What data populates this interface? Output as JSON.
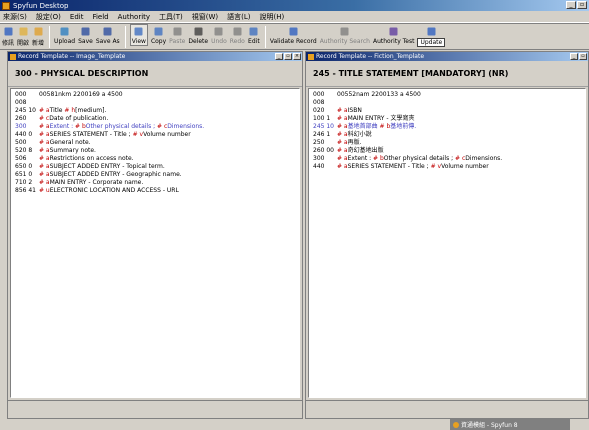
{
  "window": {
    "title": "Spyfun Desktop"
  },
  "menu": [
    "來源(S)",
    "設定(O)",
    "Edit",
    "Field",
    "Authority",
    "工具(T)",
    "視窗(W)",
    "語言(L)",
    "說明(H)"
  ],
  "toolbar": [
    {
      "label": "修訊",
      "icon": "book-icon",
      "color": "#3060c0"
    },
    {
      "label": "開啟",
      "icon": "folder-open-icon",
      "color": "#e0b040"
    },
    {
      "label": "新增",
      "icon": "new-record-icon",
      "color": "#e0a030"
    },
    {
      "label": "Upload",
      "icon": "upload-icon",
      "color": "#3080c0"
    },
    {
      "label": "Save",
      "icon": "save-icon",
      "color": "#3050a0"
    },
    {
      "label": "Save As",
      "icon": "save-as-icon",
      "color": "#3050a0"
    },
    {
      "label": "View",
      "icon": "view-icon",
      "color": "#4070c0",
      "active": true
    },
    {
      "label": "Copy",
      "icon": "copy-icon",
      "color": "#4070c0"
    },
    {
      "label": "Paste",
      "icon": "paste-icon",
      "color": "#808080",
      "disabled": true
    },
    {
      "label": "Delete",
      "icon": "delete-icon",
      "color": "#404040"
    },
    {
      "label": "Undo",
      "icon": "undo-icon",
      "color": "#808080",
      "disabled": true
    },
    {
      "label": "Redo",
      "icon": "redo-icon",
      "color": "#808080",
      "disabled": true
    },
    {
      "label": "Edit",
      "icon": "edit-icon",
      "color": "#4070c0"
    },
    {
      "label": "Validate Record",
      "icon": "validate-icon",
      "color": "#3060c0"
    },
    {
      "label": "Authority Search",
      "icon": "authority-search-icon",
      "color": "#808080",
      "disabled": true
    },
    {
      "label": "Authority Test",
      "icon": "authority-test-icon",
      "color": "#6040a0"
    },
    {
      "label": "Update",
      "icon": "update-icon",
      "color": "#3060c0",
      "boxed": true
    }
  ],
  "left_pane": {
    "title": "Record Template -- Image_Template",
    "heading": "300 - PHYSICAL DESCRIPTION",
    "lines": [
      {
        "tag": "000",
        "parts": [
          {
            "t": "00581nkm  2200169 a 4500"
          }
        ]
      },
      {
        "tag": "008",
        "parts": []
      },
      {
        "tag": "245 10",
        "parts": [
          {
            "t": "# a",
            "sf": true
          },
          {
            "t": "Title "
          },
          {
            "t": "# h",
            "sf": true
          },
          {
            "t": "[medium]."
          }
        ]
      },
      {
        "tag": "260",
        "parts": [
          {
            "t": "# c",
            "sf": true
          },
          {
            "t": "Date of publication."
          }
        ]
      },
      {
        "tag": "300",
        "hl": true,
        "parts": [
          {
            "t": "# a",
            "sf": true
          },
          {
            "t": "Extent : "
          },
          {
            "t": "# b",
            "sf": true
          },
          {
            "t": "Other physical details ; "
          },
          {
            "t": "# c",
            "sf": true
          },
          {
            "t": "Dimensions."
          }
        ]
      },
      {
        "tag": "440  0",
        "parts": [
          {
            "t": "# a",
            "sf": true
          },
          {
            "t": "SERIES STATEMENT - Title ; "
          },
          {
            "t": "# v",
            "sf": true
          },
          {
            "t": "Volume number"
          }
        ]
      },
      {
        "tag": "500",
        "parts": [
          {
            "t": "# a",
            "sf": true
          },
          {
            "t": "General note."
          }
        ]
      },
      {
        "tag": "520 8",
        "parts": [
          {
            "t": "# a",
            "sf": true
          },
          {
            "t": "Summary note."
          }
        ]
      },
      {
        "tag": "506",
        "parts": [
          {
            "t": "# a",
            "sf": true
          },
          {
            "t": "Restrictions on access note."
          }
        ]
      },
      {
        "tag": "650  0",
        "parts": [
          {
            "t": "# a",
            "sf": true
          },
          {
            "t": "SUBJECT ADDED ENTRY - Topical term."
          }
        ]
      },
      {
        "tag": "651  0",
        "parts": [
          {
            "t": "# a",
            "sf": true
          },
          {
            "t": "SUBJECT ADDED ENTRY - Geographic name."
          }
        ]
      },
      {
        "tag": "710 2",
        "parts": [
          {
            "t": "# a",
            "sf": true
          },
          {
            "t": "MAIN ENTRY - Corporate name."
          }
        ]
      },
      {
        "tag": "856 41",
        "parts": [
          {
            "t": "# u",
            "sf": true
          },
          {
            "t": "ELECTRONIC LOCATION AND ACCESS - URL"
          }
        ]
      }
    ]
  },
  "right_pane": {
    "title": "Record Template -- Fiction_Template",
    "heading": "245 - TITLE STATEMENT [MANDATORY] (NR)",
    "lines": [
      {
        "tag": "000",
        "parts": [
          {
            "t": "00552nam  2200133 a 4500"
          }
        ]
      },
      {
        "tag": "008",
        "parts": []
      },
      {
        "tag": "020",
        "parts": [
          {
            "t": "# a",
            "sf": true
          },
          {
            "t": "ISBN"
          }
        ]
      },
      {
        "tag": "100 1",
        "parts": [
          {
            "t": "# a",
            "sf": true
          },
          {
            "t": "MAIN ENTRY - 文學寫夾"
          }
        ]
      },
      {
        "tag": "245 10",
        "hl": true,
        "parts": [
          {
            "t": "# a",
            "sf": true
          },
          {
            "t": "基地首部曲 "
          },
          {
            "t": "# b",
            "sf": true
          },
          {
            "t": "基地前傳."
          }
        ]
      },
      {
        "tag": "246 1",
        "parts": [
          {
            "t": "# a",
            "sf": true
          },
          {
            "t": "科幻小說"
          }
        ]
      },
      {
        "tag": "250",
        "parts": [
          {
            "t": "# a",
            "sf": true
          },
          {
            "t": "再版."
          }
        ]
      },
      {
        "tag": "260 00",
        "parts": [
          {
            "t": "# a",
            "sf": true
          },
          {
            "t": "奇幻基地出版"
          }
        ]
      },
      {
        "tag": "300",
        "parts": [
          {
            "t": "# a",
            "sf": true
          },
          {
            "t": "Extent : "
          },
          {
            "t": "# b",
            "sf": true
          },
          {
            "t": "Other physical details ; "
          },
          {
            "t": "# c",
            "sf": true
          },
          {
            "t": "Dimensions."
          }
        ]
      },
      {
        "tag": "440",
        "parts": [
          {
            "t": "# a",
            "sf": true
          },
          {
            "t": "SERIES STATEMENT - Title ; "
          },
          {
            "t": "# v",
            "sf": true
          },
          {
            "t": "Volume number"
          }
        ]
      }
    ]
  },
  "status": {
    "chip": "資通模組 - Spyfun 8"
  }
}
